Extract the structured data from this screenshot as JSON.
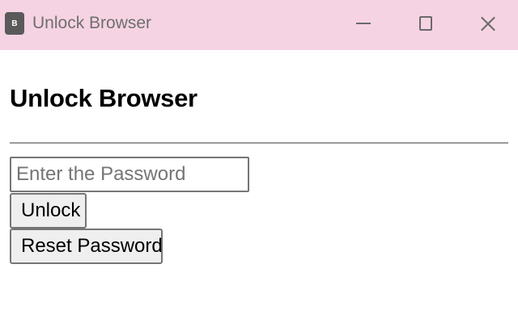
{
  "window": {
    "title": "Unlock Browser",
    "icon_letter": "B",
    "controls": [
      "minimize-icon",
      "maximize-icon",
      "close-icon"
    ],
    "titlebar_color": "#f6d3e2"
  },
  "page": {
    "heading": "Unlock Browser"
  },
  "form": {
    "password_placeholder": "Enter the Password",
    "password_value": "",
    "unlock_label": "Unlock",
    "reset_label": "Reset Password"
  }
}
